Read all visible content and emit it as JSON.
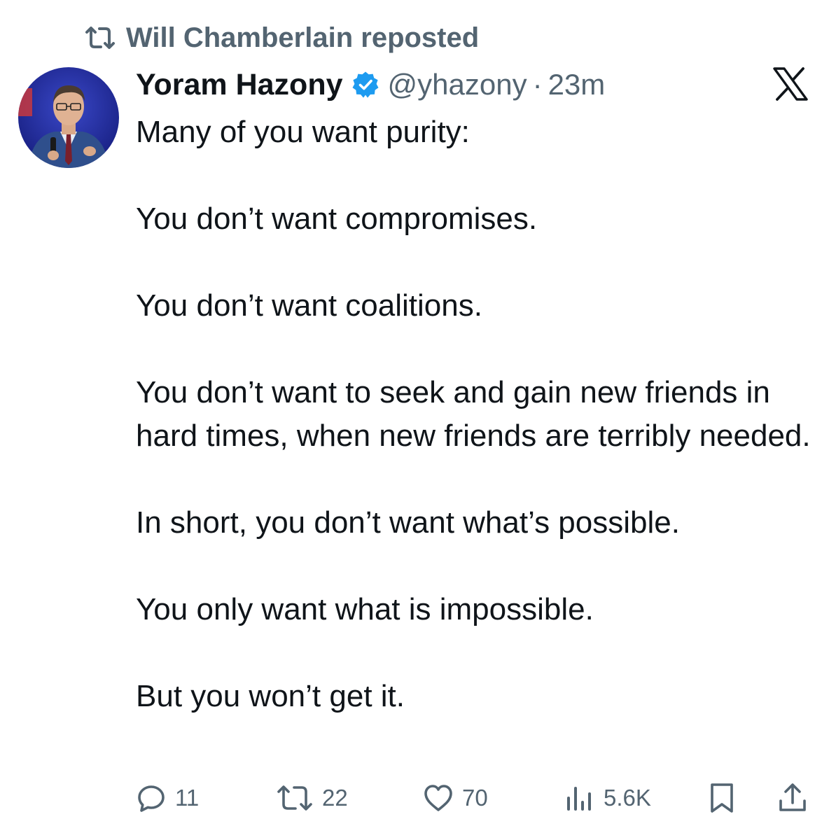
{
  "repost": {
    "icon": "repost-icon",
    "label": "Will Chamberlain reposted"
  },
  "tweet": {
    "author_name": "Yoram Hazony",
    "verified": true,
    "verified_color": "#1d9bf0",
    "handle": "@yhazony",
    "separator": "·",
    "time": "23m",
    "platform_logo": "x-logo",
    "paragraphs": [
      "Many of you want purity:",
      "You don’t want compromises.",
      "You don’t want coalitions.",
      "You don’t want to seek and gain new friends in hard times, when new friends are terribly needed.",
      "In short, you don’t want what’s possible.",
      "You only want what is impossible.",
      "But you won’t get it."
    ]
  },
  "actions": {
    "replies": "11",
    "reposts": "22",
    "likes": "70",
    "views": "5.6K"
  },
  "colors": {
    "text_primary": "#0f1419",
    "text_secondary": "#536471",
    "accent": "#1d9bf0"
  }
}
